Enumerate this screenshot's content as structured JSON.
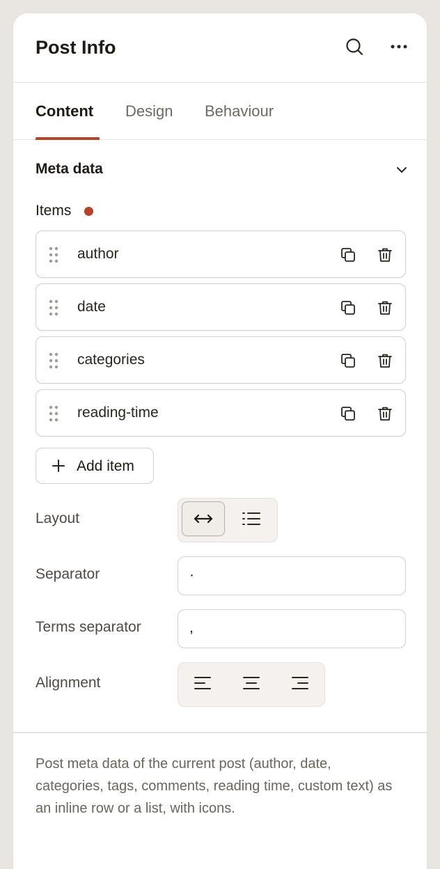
{
  "header": {
    "title": "Post Info",
    "search_icon": "search-icon",
    "more_icon": "more-horizontal-icon"
  },
  "tabs": [
    {
      "label": "Content",
      "active": true
    },
    {
      "label": "Design",
      "active": false
    },
    {
      "label": "Behaviour",
      "active": false
    }
  ],
  "section": {
    "title": "Meta data",
    "collapse_icon": "chevron-down-icon"
  },
  "items": {
    "label": "Items",
    "required": true,
    "list": [
      {
        "label": "author"
      },
      {
        "label": "date"
      },
      {
        "label": "categories"
      },
      {
        "label": "reading-time"
      }
    ],
    "add_label": "Add item"
  },
  "layout": {
    "label": "Layout",
    "options": [
      "inline-arrows-icon",
      "list-icon"
    ],
    "selected": "inline-arrows-icon"
  },
  "separator": {
    "label": "Separator",
    "value": "·"
  },
  "terms_separator": {
    "label": "Terms separator",
    "value": ","
  },
  "alignment": {
    "label": "Alignment",
    "options": [
      "align-left-icon",
      "align-center-icon",
      "align-right-icon"
    ]
  },
  "footer": {
    "description": "Post meta data of the current post (author, date, categories, tags, comments, reading time, custom text) as an inline row or a list, with icons."
  },
  "colors": {
    "accent": "#b5442a",
    "panel": "#ffffff",
    "background": "#e9e5e1"
  }
}
